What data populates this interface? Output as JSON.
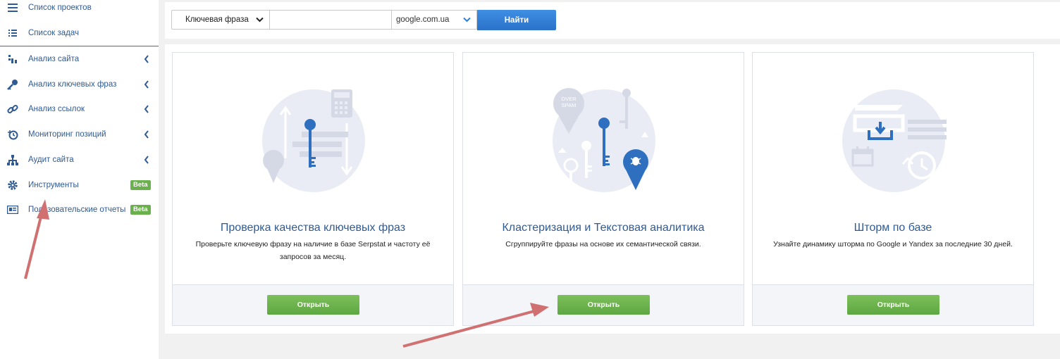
{
  "sidebar": {
    "items": [
      {
        "label": "Список проектов",
        "icon": "menu-icon"
      },
      {
        "label": "Список задач",
        "icon": "list-icon"
      },
      {
        "label": "Анализ сайта",
        "icon": "chart-icon",
        "expandable": true
      },
      {
        "label": "Анализ ключевых фраз",
        "icon": "key-icon",
        "expandable": true
      },
      {
        "label": "Анализ ссылок",
        "icon": "link-icon",
        "expandable": true
      },
      {
        "label": "Мониторинг позиций",
        "icon": "history-icon",
        "expandable": true
      },
      {
        "label": "Аудит сайта",
        "icon": "sitemap-icon",
        "expandable": true
      },
      {
        "label": "Инструменты",
        "icon": "gear-icon",
        "badge": "Beta"
      },
      {
        "label": "Пользовательские отчеты",
        "icon": "report-icon",
        "badge": "Beta"
      }
    ]
  },
  "search": {
    "mode_label": "Ключевая фраза",
    "query_value": "",
    "database_label": "google.com.ua",
    "submit_label": "Найти"
  },
  "cards": [
    {
      "title": "Проверка качества ключевых фраз",
      "description": "Проверьте ключевую фразу на наличие в базе Serpstat и частоту её запросов за месяц.",
      "button_label": "Открыть"
    },
    {
      "title": "Кластеризация и Текстовая аналитика",
      "description": "Сгруппируйте фразы на основе их семантической связи.",
      "button_label": "Открыть",
      "illustration_badge": "OVER SPAM"
    },
    {
      "title": "Шторм по базе",
      "description": "Узнайте динамику шторма по Google и Yandex за последние 30 дней.",
      "button_label": "Открыть"
    }
  ],
  "colors": {
    "link_blue": "#2f5a94",
    "primary_button": "#2f7fd6",
    "open_button": "#6ab04c",
    "annotation_arrow": "#cc6666"
  }
}
